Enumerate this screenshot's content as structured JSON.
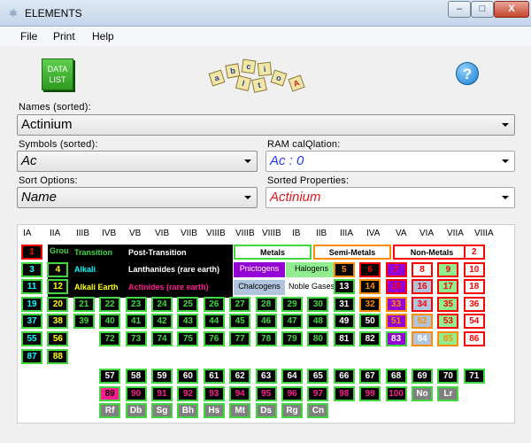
{
  "window": {
    "title": "ELEMENTS",
    "minimize": "–",
    "maximize": "□",
    "close": "X"
  },
  "menu": [
    "File",
    "Print",
    "Help"
  ],
  "toolbar": {
    "datalist_line1": "DATA",
    "datalist_line2": "LIST",
    "logo_letters": [
      "a",
      "b",
      "c",
      "i",
      "l",
      "t",
      "o",
      "A"
    ],
    "help": "?"
  },
  "names": {
    "label": "Names (sorted):",
    "value": "Actinium"
  },
  "symbols": {
    "label": "Symbols (sorted):",
    "value": "Ac"
  },
  "ram": {
    "label": "RAM calQlation:",
    "value": "Ac : 0"
  },
  "sort_options": {
    "label": "Sort Options:",
    "value": "Name"
  },
  "sorted_props": {
    "label": "Sorted Properties:",
    "value": "Actinium"
  },
  "group_headers": [
    "IA",
    "IIA",
    "IIIB",
    "IVB",
    "VB",
    "VIB",
    "VIIB",
    "VIIIB",
    "VIIIB",
    "VIIIB",
    "IB",
    "IIB",
    "IIIA",
    "IVA",
    "VA",
    "VIA",
    "VIIA",
    "VIIIA"
  ],
  "legend": {
    "grou": "Grou",
    "transition": "Transition",
    "post_transition": "Post-Transition",
    "alkali": "Alkali",
    "lanthanides": "Lanthanides (rare earth)",
    "alkali_earth": "Alkali Earth",
    "actinides": "Actinides (rare earth)",
    "metals": "Metals",
    "semi_metals": "Semi-Metals",
    "non_metals": "Non-Metals",
    "pnictogens": "Pnictogens",
    "halogens": "Halogens",
    "chalcogens": "Chalcogens",
    "noble_gases": "Noble Gases"
  },
  "colors": {
    "green": "#3fd93f",
    "yellow": "#ffff00",
    "cyan": "#00ffff",
    "white": "#ffffff",
    "pink": "#ff1c8f",
    "orange": "#ff8c00",
    "red": "#ff0000",
    "purple": "#9400d3",
    "lightgreen": "#90ee90",
    "lightblue": "#b0c4de",
    "gray": "#808080",
    "black": "#000000"
  },
  "elements": [
    {
      "n": "1",
      "c": 1,
      "r": 1,
      "bg": "black",
      "fg": "red",
      "bd": "red"
    },
    {
      "n": "2",
      "c": 18,
      "r": 1,
      "bg": "white",
      "fg": "red",
      "bd": "red"
    },
    {
      "n": "3",
      "c": 1,
      "r": 2,
      "bg": "black",
      "fg": "cyan",
      "bd": "green"
    },
    {
      "n": "4",
      "c": 2,
      "r": 2,
      "bg": "black",
      "fg": "yellow",
      "bd": "green"
    },
    {
      "n": "5",
      "c": 13,
      "r": 2,
      "bg": "black",
      "fg": "orange",
      "bd": "orange"
    },
    {
      "n": "6",
      "c": 14,
      "r": 2,
      "bg": "black",
      "fg": "red",
      "bd": "red"
    },
    {
      "n": "7",
      "c": 15,
      "r": 2,
      "bg": "purple",
      "fg": "red",
      "bd": "red"
    },
    {
      "n": "8",
      "c": 16,
      "r": 2,
      "bg": "white",
      "fg": "red",
      "bd": "red"
    },
    {
      "n": "9",
      "c": 17,
      "r": 2,
      "bg": "lightgreen",
      "fg": "red",
      "bd": "red"
    },
    {
      "n": "10",
      "c": 18,
      "r": 2,
      "bg": "white",
      "fg": "red",
      "bd": "red"
    },
    {
      "n": "11",
      "c": 1,
      "r": 3,
      "bg": "black",
      "fg": "cyan",
      "bd": "green"
    },
    {
      "n": "12",
      "c": 2,
      "r": 3,
      "bg": "black",
      "fg": "yellow",
      "bd": "green"
    },
    {
      "n": "13",
      "c": 13,
      "r": 3,
      "bg": "black",
      "fg": "white",
      "bd": "green"
    },
    {
      "n": "14",
      "c": 14,
      "r": 3,
      "bg": "black",
      "fg": "orange",
      "bd": "orange"
    },
    {
      "n": "15",
      "c": 15,
      "r": 3,
      "bg": "purple",
      "fg": "red",
      "bd": "red"
    },
    {
      "n": "16",
      "c": 16,
      "r": 3,
      "bg": "lightblue",
      "fg": "red",
      "bd": "red"
    },
    {
      "n": "17",
      "c": 17,
      "r": 3,
      "bg": "lightgreen",
      "fg": "red",
      "bd": "red"
    },
    {
      "n": "18",
      "c": 18,
      "r": 3,
      "bg": "white",
      "fg": "red",
      "bd": "red"
    },
    {
      "n": "19",
      "c": 1,
      "r": 4,
      "bg": "black",
      "fg": "cyan",
      "bd": "green"
    },
    {
      "n": "20",
      "c": 2,
      "r": 4,
      "bg": "black",
      "fg": "yellow",
      "bd": "green"
    },
    {
      "n": "21",
      "c": 3,
      "r": 4,
      "bg": "black",
      "fg": "green",
      "bd": "green"
    },
    {
      "n": "22",
      "c": 4,
      "r": 4,
      "bg": "black",
      "fg": "green",
      "bd": "green"
    },
    {
      "n": "23",
      "c": 5,
      "r": 4,
      "bg": "black",
      "fg": "green",
      "bd": "green"
    },
    {
      "n": "24",
      "c": 6,
      "r": 4,
      "bg": "black",
      "fg": "green",
      "bd": "green"
    },
    {
      "n": "25",
      "c": 7,
      "r": 4,
      "bg": "black",
      "fg": "green",
      "bd": "green"
    },
    {
      "n": "26",
      "c": 8,
      "r": 4,
      "bg": "black",
      "fg": "green",
      "bd": "green"
    },
    {
      "n": "27",
      "c": 9,
      "r": 4,
      "bg": "black",
      "fg": "green",
      "bd": "green"
    },
    {
      "n": "28",
      "c": 10,
      "r": 4,
      "bg": "black",
      "fg": "green",
      "bd": "green"
    },
    {
      "n": "29",
      "c": 11,
      "r": 4,
      "bg": "black",
      "fg": "green",
      "bd": "green"
    },
    {
      "n": "30",
      "c": 12,
      "r": 4,
      "bg": "black",
      "fg": "green",
      "bd": "green"
    },
    {
      "n": "31",
      "c": 13,
      "r": 4,
      "bg": "black",
      "fg": "white",
      "bd": "green"
    },
    {
      "n": "32",
      "c": 14,
      "r": 4,
      "bg": "black",
      "fg": "orange",
      "bd": "orange"
    },
    {
      "n": "33",
      "c": 15,
      "r": 4,
      "bg": "purple",
      "fg": "orange",
      "bd": "orange"
    },
    {
      "n": "34",
      "c": 16,
      "r": 4,
      "bg": "lightblue",
      "fg": "red",
      "bd": "red"
    },
    {
      "n": "35",
      "c": 17,
      "r": 4,
      "bg": "lightgreen",
      "fg": "red",
      "bd": "red"
    },
    {
      "n": "36",
      "c": 18,
      "r": 4,
      "bg": "white",
      "fg": "red",
      "bd": "red"
    },
    {
      "n": "37",
      "c": 1,
      "r": 5,
      "bg": "black",
      "fg": "cyan",
      "bd": "green"
    },
    {
      "n": "38",
      "c": 2,
      "r": 5,
      "bg": "black",
      "fg": "yellow",
      "bd": "green"
    },
    {
      "n": "39",
      "c": 3,
      "r": 5,
      "bg": "black",
      "fg": "green",
      "bd": "green"
    },
    {
      "n": "40",
      "c": 4,
      "r": 5,
      "bg": "black",
      "fg": "green",
      "bd": "green"
    },
    {
      "n": "41",
      "c": 5,
      "r": 5,
      "bg": "black",
      "fg": "green",
      "bd": "green"
    },
    {
      "n": "42",
      "c": 6,
      "r": 5,
      "bg": "black",
      "fg": "green",
      "bd": "green"
    },
    {
      "n": "43",
      "c": 7,
      "r": 5,
      "bg": "black",
      "fg": "green",
      "bd": "green"
    },
    {
      "n": "44",
      "c": 8,
      "r": 5,
      "bg": "black",
      "fg": "green",
      "bd": "green"
    },
    {
      "n": "45",
      "c": 9,
      "r": 5,
      "bg": "black",
      "fg": "green",
      "bd": "green"
    },
    {
      "n": "46",
      "c": 10,
      "r": 5,
      "bg": "black",
      "fg": "green",
      "bd": "green"
    },
    {
      "n": "47",
      "c": 11,
      "r": 5,
      "bg": "black",
      "fg": "green",
      "bd": "green"
    },
    {
      "n": "48",
      "c": 12,
      "r": 5,
      "bg": "black",
      "fg": "green",
      "bd": "green"
    },
    {
      "n": "49",
      "c": 13,
      "r": 5,
      "bg": "black",
      "fg": "white",
      "bd": "green"
    },
    {
      "n": "50",
      "c": 14,
      "r": 5,
      "bg": "black",
      "fg": "white",
      "bd": "green"
    },
    {
      "n": "51",
      "c": 15,
      "r": 5,
      "bg": "purple",
      "fg": "orange",
      "bd": "orange"
    },
    {
      "n": "52",
      "c": 16,
      "r": 5,
      "bg": "lightblue",
      "fg": "orange",
      "bd": "orange"
    },
    {
      "n": "53",
      "c": 17,
      "r": 5,
      "bg": "lightgreen",
      "fg": "red",
      "bd": "red"
    },
    {
      "n": "54",
      "c": 18,
      "r": 5,
      "bg": "white",
      "fg": "red",
      "bd": "red"
    },
    {
      "n": "55",
      "c": 1,
      "r": 6,
      "bg": "black",
      "fg": "cyan",
      "bd": "green"
    },
    {
      "n": "56",
      "c": 2,
      "r": 6,
      "bg": "black",
      "fg": "yellow",
      "bd": "green"
    },
    {
      "n": "72",
      "c": 4,
      "r": 6,
      "bg": "black",
      "fg": "green",
      "bd": "green"
    },
    {
      "n": "73",
      "c": 5,
      "r": 6,
      "bg": "black",
      "fg": "green",
      "bd": "green"
    },
    {
      "n": "74",
      "c": 6,
      "r": 6,
      "bg": "black",
      "fg": "green",
      "bd": "green"
    },
    {
      "n": "75",
      "c": 7,
      "r": 6,
      "bg": "black",
      "fg": "green",
      "bd": "green"
    },
    {
      "n": "76",
      "c": 8,
      "r": 6,
      "bg": "black",
      "fg": "green",
      "bd": "green"
    },
    {
      "n": "77",
      "c": 9,
      "r": 6,
      "bg": "black",
      "fg": "green",
      "bd": "green"
    },
    {
      "n": "78",
      "c": 10,
      "r": 6,
      "bg": "black",
      "fg": "green",
      "bd": "green"
    },
    {
      "n": "79",
      "c": 11,
      "r": 6,
      "bg": "black",
      "fg": "green",
      "bd": "green"
    },
    {
      "n": "80",
      "c": 12,
      "r": 6,
      "bg": "black",
      "fg": "green",
      "bd": "green"
    },
    {
      "n": "81",
      "c": 13,
      "r": 6,
      "bg": "black",
      "fg": "white",
      "bd": "green"
    },
    {
      "n": "82",
      "c": 14,
      "r": 6,
      "bg": "black",
      "fg": "white",
      "bd": "green"
    },
    {
      "n": "83",
      "c": 15,
      "r": 6,
      "bg": "purple",
      "fg": "white",
      "bd": "green"
    },
    {
      "n": "84",
      "c": 16,
      "r": 6,
      "bg": "lightblue",
      "fg": "white",
      "bd": "orange"
    },
    {
      "n": "85",
      "c": 17,
      "r": 6,
      "bg": "lightgreen",
      "fg": "orange",
      "bd": "orange"
    },
    {
      "n": "86",
      "c": 18,
      "r": 6,
      "bg": "white",
      "fg": "red",
      "bd": "red"
    },
    {
      "n": "87",
      "c": 1,
      "r": 7,
      "bg": "black",
      "fg": "cyan",
      "bd": "green"
    },
    {
      "n": "88",
      "c": 2,
      "r": 7,
      "bg": "black",
      "fg": "yellow",
      "bd": "green"
    },
    {
      "n": "57",
      "c": 4,
      "r": 8,
      "bg": "black",
      "fg": "white",
      "bd": "green"
    },
    {
      "n": "58",
      "c": 5,
      "r": 8,
      "bg": "black",
      "fg": "white",
      "bd": "green"
    },
    {
      "n": "59",
      "c": 6,
      "r": 8,
      "bg": "black",
      "fg": "white",
      "bd": "green"
    },
    {
      "n": "60",
      "c": 7,
      "r": 8,
      "bg": "black",
      "fg": "white",
      "bd": "green"
    },
    {
      "n": "61",
      "c": 8,
      "r": 8,
      "bg": "black",
      "fg": "white",
      "bd": "green"
    },
    {
      "n": "62",
      "c": 9,
      "r": 8,
      "bg": "black",
      "fg": "white",
      "bd": "green"
    },
    {
      "n": "63",
      "c": 10,
      "r": 8,
      "bg": "black",
      "fg": "white",
      "bd": "green"
    },
    {
      "n": "64",
      "c": 11,
      "r": 8,
      "bg": "black",
      "fg": "white",
      "bd": "green"
    },
    {
      "n": "65",
      "c": 12,
      "r": 8,
      "bg": "black",
      "fg": "white",
      "bd": "green"
    },
    {
      "n": "66",
      "c": 13,
      "r": 8,
      "bg": "black",
      "fg": "white",
      "bd": "green"
    },
    {
      "n": "67",
      "c": 14,
      "r": 8,
      "bg": "black",
      "fg": "white",
      "bd": "green"
    },
    {
      "n": "68",
      "c": 15,
      "r": 8,
      "bg": "black",
      "fg": "white",
      "bd": "green"
    },
    {
      "n": "69",
      "c": 16,
      "r": 8,
      "bg": "black",
      "fg": "white",
      "bd": "green"
    },
    {
      "n": "70",
      "c": 17,
      "r": 8,
      "bg": "black",
      "fg": "white",
      "bd": "green"
    },
    {
      "n": "71",
      "c": 18,
      "r": 8,
      "bg": "black",
      "fg": "white",
      "bd": "green"
    },
    {
      "n": "89",
      "c": 4,
      "r": 9,
      "bg": "pink",
      "fg": "black",
      "bd": "green"
    },
    {
      "n": "90",
      "c": 5,
      "r": 9,
      "bg": "black",
      "fg": "pink",
      "bd": "green"
    },
    {
      "n": "91",
      "c": 6,
      "r": 9,
      "bg": "black",
      "fg": "pink",
      "bd": "green"
    },
    {
      "n": "92",
      "c": 7,
      "r": 9,
      "bg": "black",
      "fg": "pink",
      "bd": "green"
    },
    {
      "n": "93",
      "c": 8,
      "r": 9,
      "bg": "black",
      "fg": "pink",
      "bd": "green"
    },
    {
      "n": "94",
      "c": 9,
      "r": 9,
      "bg": "black",
      "fg": "pink",
      "bd": "green"
    },
    {
      "n": "95",
      "c": 10,
      "r": 9,
      "bg": "black",
      "fg": "pink",
      "bd": "green"
    },
    {
      "n": "96",
      "c": 11,
      "r": 9,
      "bg": "black",
      "fg": "pink",
      "bd": "green"
    },
    {
      "n": "97",
      "c": 12,
      "r": 9,
      "bg": "black",
      "fg": "pink",
      "bd": "green"
    },
    {
      "n": "98",
      "c": 13,
      "r": 9,
      "bg": "black",
      "fg": "pink",
      "bd": "green"
    },
    {
      "n": "99",
      "c": 14,
      "r": 9,
      "bg": "black",
      "fg": "pink",
      "bd": "green"
    },
    {
      "n": "100",
      "c": 15,
      "r": 9,
      "bg": "black",
      "fg": "pink",
      "bd": "green"
    },
    {
      "n": "No",
      "c": 16,
      "r": 9,
      "bg": "gray",
      "fg": "white",
      "bd": "green"
    },
    {
      "n": "Lr",
      "c": 17,
      "r": 9,
      "bg": "gray",
      "fg": "white",
      "bd": "green"
    },
    {
      "n": "Rf",
      "c": 4,
      "r": 10,
      "bg": "gray",
      "fg": "white",
      "bd": "green"
    },
    {
      "n": "Db",
      "c": 5,
      "r": 10,
      "bg": "gray",
      "fg": "white",
      "bd": "green"
    },
    {
      "n": "Sg",
      "c": 6,
      "r": 10,
      "bg": "gray",
      "fg": "white",
      "bd": "green"
    },
    {
      "n": "Bh",
      "c": 7,
      "r": 10,
      "bg": "gray",
      "fg": "white",
      "bd": "green"
    },
    {
      "n": "Hs",
      "c": 8,
      "r": 10,
      "bg": "gray",
      "fg": "white",
      "bd": "green"
    },
    {
      "n": "Mt",
      "c": 9,
      "r": 10,
      "bg": "gray",
      "fg": "white",
      "bd": "green"
    },
    {
      "n": "Ds",
      "c": 10,
      "r": 10,
      "bg": "gray",
      "fg": "white",
      "bd": "green"
    },
    {
      "n": "Rg",
      "c": 11,
      "r": 10,
      "bg": "gray",
      "fg": "white",
      "bd": "green"
    },
    {
      "n": "Cn",
      "c": 12,
      "r": 10,
      "bg": "gray",
      "fg": "white",
      "bd": "green"
    }
  ]
}
